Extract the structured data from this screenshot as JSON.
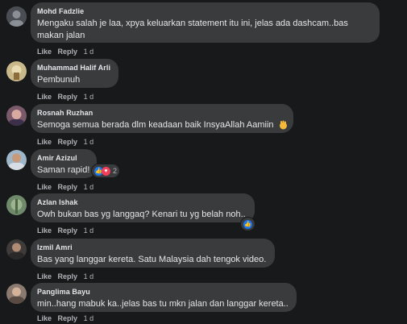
{
  "actions": {
    "like": "Like",
    "reply": "Reply"
  },
  "comments": [
    {
      "name": "Mohd Fadzlie",
      "text_lines": [
        "Mengaku salah je laa, xpya keluarkan statement itu ini, jelas ada dashcam..bas",
        "makan jalan"
      ],
      "time": "1 d"
    },
    {
      "name": "Muhammad Halif Arli",
      "text_lines": [
        "Pembunuh"
      ],
      "time": "1 d"
    },
    {
      "name": "Rosnah Ruzhan",
      "text_lines": [
        "Semoga semua berada dlm keadaan baik InsyaAllah Aamiin"
      ],
      "emoji": "wave-emoji",
      "time": "1 d"
    },
    {
      "name": "Amir Azizul",
      "text_lines": [
        "Saman rapid!"
      ],
      "time": "1 d",
      "reactions": {
        "icons": [
          "like-icon",
          "love-icon"
        ],
        "count": "2"
      }
    },
    {
      "name": "Azlan Ishak",
      "text_lines": [
        "Owh bukan bas yg langgaq? Kenari tu yg belah noh.."
      ],
      "time": "1 d",
      "reactions": {
        "icons": [
          "like-icon"
        ],
        "count": ""
      }
    },
    {
      "name": "Izmil Amri",
      "text_lines": [
        "Bas yang langgar kereta. Satu Malaysia dah tengok video."
      ],
      "time": "1 d"
    },
    {
      "name": "Panglima Bayu",
      "text_lines": [
        "min..hang mabuk ka..jelas bas tu mkn jalan dan langgar kereta.."
      ],
      "time": "1 d"
    }
  ],
  "colors": {
    "background": "#18191a",
    "bubble": "#3a3b3c",
    "text": "#e4e6eb",
    "meta": "#b0b3b8",
    "like": "#1877f2",
    "love": "#f33e58"
  }
}
